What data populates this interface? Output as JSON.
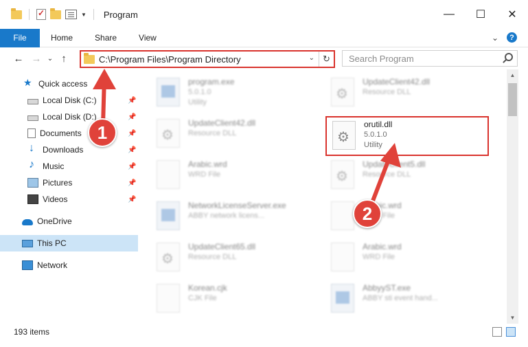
{
  "window": {
    "title": "Program",
    "controls": {
      "minimize": "—",
      "maximize": "☐",
      "close": "✕"
    }
  },
  "ribbon": {
    "tabs": [
      "File",
      "Home",
      "Share",
      "View"
    ],
    "expand": "⌄",
    "help": "?"
  },
  "nav": {
    "back": "←",
    "forward": "→",
    "recent": "⌄",
    "up": "↑"
  },
  "address": {
    "path": "C:\\Program Files\\Program Directory",
    "dropdown": "⌄",
    "refresh": "↻"
  },
  "search": {
    "placeholder": "Search Program"
  },
  "sidebar": {
    "items": [
      {
        "label": "Quick access",
        "icon": "star-icon"
      },
      {
        "label": "Local Disk (C:)",
        "icon": "disk-icon",
        "pinned": true
      },
      {
        "label": "Local Disk (D:)",
        "icon": "disk-icon",
        "pinned": true
      },
      {
        "label": "Documents",
        "icon": "documents-icon",
        "pinned": true
      },
      {
        "label": "Downloads",
        "icon": "downloads-icon",
        "pinned": true
      },
      {
        "label": "Music",
        "icon": "music-icon",
        "pinned": true
      },
      {
        "label": "Pictures",
        "icon": "pictures-icon",
        "pinned": true
      },
      {
        "label": "Videos",
        "icon": "videos-icon",
        "pinned": true
      },
      {
        "label": "OneDrive",
        "icon": "onedrive-icon"
      },
      {
        "label": "This PC",
        "icon": "this-pc-icon",
        "selected": true
      },
      {
        "label": "Network",
        "icon": "network-icon"
      }
    ],
    "pin_glyph": "📌"
  },
  "files": [
    {
      "name": "program.exe",
      "line2": "5.0.1.0",
      "line3": "Utility",
      "type": "exe"
    },
    {
      "name": "UpdateClient42.dll",
      "line2": "Resource DLL",
      "line3": "",
      "type": "dll"
    },
    {
      "name": "UpdateClient42.dll",
      "line2": "Resource DLL",
      "line3": "",
      "type": "dll"
    },
    {
      "name": "orutil.dll",
      "line2": "5.0.1.0",
      "line3": "Utility",
      "type": "dll",
      "highlighted": true
    },
    {
      "name": "Arabic.wrd",
      "line2": "WRD File",
      "line3": "",
      "type": "doc"
    },
    {
      "name": "UpdateClient5.dll",
      "line2": "Resource DLL",
      "line3": "",
      "type": "dll"
    },
    {
      "name": "NetworkLicenseServer.exe",
      "line2": "ABBY network licens...",
      "line3": "",
      "type": "exe"
    },
    {
      "name": "Arabic.wrd",
      "line2": "WRD File",
      "line3": "",
      "type": "doc"
    },
    {
      "name": "UpdateClient65.dll",
      "line2": "Resource DLL",
      "line3": "",
      "type": "dll"
    },
    {
      "name": "Arabic.wrd",
      "line2": "WRD File",
      "line3": "",
      "type": "doc"
    },
    {
      "name": "Korean.cjk",
      "line2": "CJK File",
      "line3": "",
      "type": "doc"
    },
    {
      "name": "AbbyyST.exe",
      "line2": "ABBY sti event hand...",
      "line3": "",
      "type": "exe"
    }
  ],
  "status": {
    "item_count": "193 items"
  },
  "annotations": {
    "step1": "1",
    "step2": "2",
    "color": "#e0423a"
  },
  "scroll": {
    "up": "▲",
    "down": "▼"
  }
}
